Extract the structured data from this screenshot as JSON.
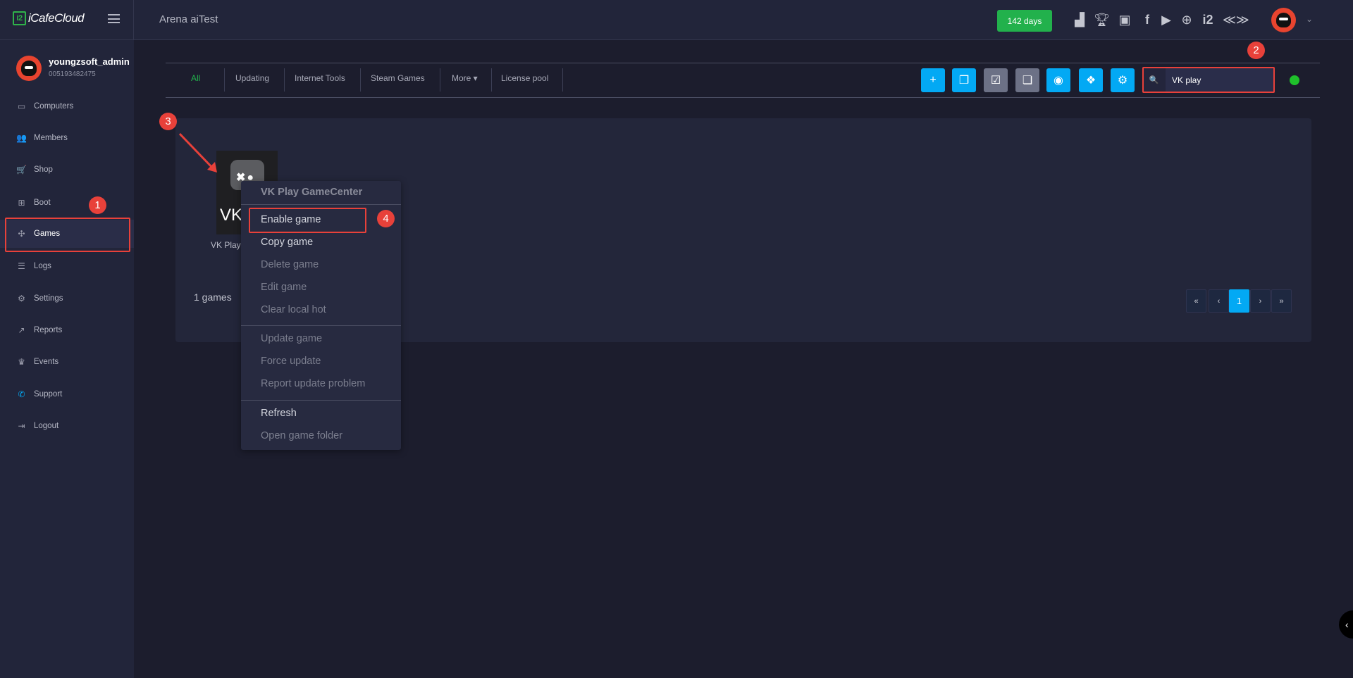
{
  "header": {
    "logo": "iCafeCloud",
    "logo_mark": "i2",
    "title": "Arena aiTest",
    "days_badge": "142 days",
    "icons": [
      "leaderboard-icon",
      "trophy-icon",
      "discord-icon",
      "facebook-icon",
      "youtube-icon",
      "globe-icon",
      "icafe-icon",
      "brand-icon"
    ]
  },
  "user": {
    "name": "youngzsoft_admin",
    "id": "005193482475"
  },
  "sidebar": {
    "items": [
      {
        "label": "Computers",
        "icon": "▭"
      },
      {
        "label": "Members",
        "icon": "👥"
      },
      {
        "label": "Shop",
        "icon": "🛒"
      },
      {
        "label": "Boot",
        "icon": "⊞"
      },
      {
        "label": "Games",
        "icon": "✣"
      },
      {
        "label": "Logs",
        "icon": "☰"
      },
      {
        "label": "Settings",
        "icon": "⚙"
      },
      {
        "label": "Reports",
        "icon": "↗"
      },
      {
        "label": "Events",
        "icon": "♛"
      },
      {
        "label": "Support",
        "icon": "✆"
      },
      {
        "label": "Logout",
        "icon": "⇥"
      }
    ]
  },
  "tabs": [
    {
      "label": "All"
    },
    {
      "label": "Updating"
    },
    {
      "label": "Internet Tools"
    },
    {
      "label": "Steam Games"
    },
    {
      "label": "More ▾"
    },
    {
      "label": "License pool"
    }
  ],
  "toolbar": {
    "buttons": [
      "+",
      "❐",
      "☑",
      "❏",
      "◉",
      "❖",
      "⚙"
    ]
  },
  "search": {
    "value": "VK play",
    "icon": "🔍"
  },
  "game": {
    "name": "VK Play",
    "tile_text": "VK",
    "logo_text": "✖●"
  },
  "count": "1 games",
  "context_menu": {
    "title": "VK Play GameCenter",
    "items": [
      "Enable game",
      "Copy game",
      "Delete game",
      "Edit game",
      "Clear local hot",
      "Update game",
      "Force update",
      "Report update problem",
      "Refresh",
      "Open game folder"
    ]
  },
  "pagination": [
    "«",
    "‹",
    "1",
    "›",
    "»"
  ],
  "annotations": [
    "1",
    "2",
    "3",
    "4"
  ],
  "colors": {
    "accent": "#03a9f4",
    "green": "#22b14c",
    "annotation": "#e8413a"
  }
}
